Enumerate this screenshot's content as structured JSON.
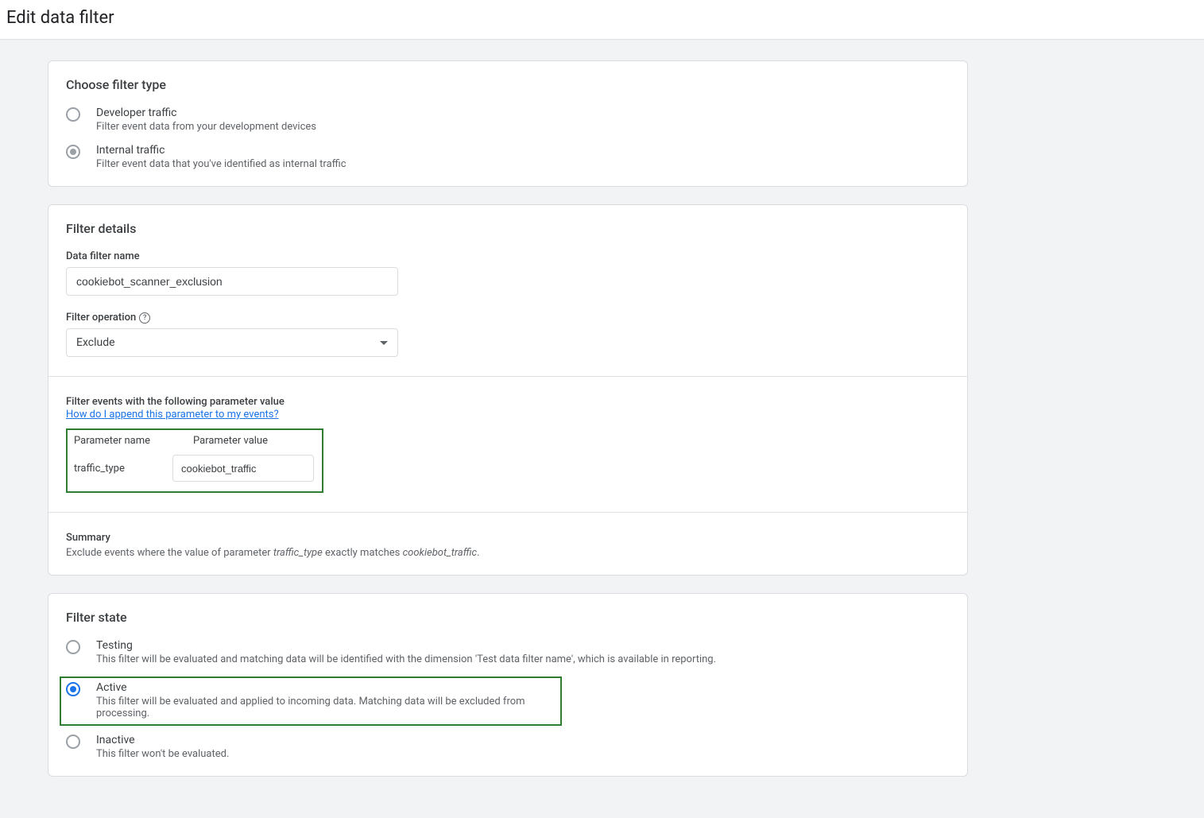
{
  "page": {
    "title": "Edit data filter"
  },
  "filterType": {
    "heading": "Choose filter type",
    "options": [
      {
        "label": "Developer traffic",
        "desc": "Filter event data from your development devices"
      },
      {
        "label": "Internal traffic",
        "desc": "Filter event data that you've identified as internal traffic"
      }
    ]
  },
  "details": {
    "heading": "Filter details",
    "nameLabel": "Data filter name",
    "nameValue": "cookiebot_scanner_exclusion",
    "operationLabel": "Filter operation",
    "operationValue": "Exclude",
    "paramSectionLabel": "Filter events with the following parameter value",
    "helpLink": "How do I append this parameter to my events?",
    "paramNameHeader": "Parameter name",
    "paramValueHeader": "Parameter value",
    "paramName": "traffic_type",
    "paramValue": "cookiebot_traffic",
    "summaryLabel": "Summary",
    "summary": {
      "pre": "Exclude events where the value of parameter ",
      "p1": "traffic_type",
      "mid": " exactly matches ",
      "p2": "cookiebot_traffic",
      "post": "."
    }
  },
  "state": {
    "heading": "Filter state",
    "options": [
      {
        "label": "Testing",
        "desc": "This filter will be evaluated and matching data will be identified with the dimension 'Test data filter name', which is available in reporting."
      },
      {
        "label": "Active",
        "desc": "This filter will be evaluated and applied to incoming data. Matching data will be excluded from processing."
      },
      {
        "label": "Inactive",
        "desc": "This filter won't be evaluated."
      }
    ]
  },
  "helpQ": "?"
}
